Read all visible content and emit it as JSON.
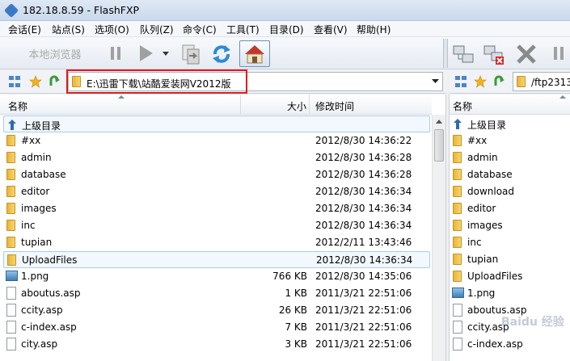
{
  "window": {
    "title": "182.18.8.59 - FlashFXP"
  },
  "menu": [
    "会话(E)",
    "站点(S)",
    "选项(O)",
    "队列(Z)",
    "命令(C)",
    "工具(T)",
    "目录(D)",
    "查看(V)",
    "帮助(H)"
  ],
  "toolbar": {
    "local_browser_label": "本地浏览器"
  },
  "left": {
    "path": "E:\\迅雷下载\\站酷爱装网V2012版",
    "columns": {
      "name": "名称",
      "size": "大小",
      "modified": "修改时间"
    },
    "parent_label": "上级目录",
    "rows": [
      {
        "name": "#xx",
        "size": "",
        "modified": "2012/8/30 14:36:22",
        "type": "folder"
      },
      {
        "name": "admin",
        "size": "",
        "modified": "2012/8/30 14:36:28",
        "type": "folder"
      },
      {
        "name": "database",
        "size": "",
        "modified": "2012/8/30 14:36:28",
        "type": "folder"
      },
      {
        "name": "editor",
        "size": "",
        "modified": "2012/8/30 14:36:34",
        "type": "folder"
      },
      {
        "name": "images",
        "size": "",
        "modified": "2012/8/30 14:36:34",
        "type": "folder"
      },
      {
        "name": "inc",
        "size": "",
        "modified": "2012/8/30 14:36:34",
        "type": "folder"
      },
      {
        "name": "tupian",
        "size": "",
        "modified": "2012/2/11 13:43:46",
        "type": "folder"
      },
      {
        "name": "UploadFiles",
        "size": "",
        "modified": "2012/8/30 14:36:34",
        "type": "folder"
      },
      {
        "name": "1.png",
        "size": "766 KB",
        "modified": "2012/8/30 14:35:06",
        "type": "png"
      },
      {
        "name": "aboutus.asp",
        "size": "1 KB",
        "modified": "2011/3/21 22:51:06",
        "type": "file"
      },
      {
        "name": "ccity.asp",
        "size": "26 KB",
        "modified": "2011/3/21 22:51:06",
        "type": "file"
      },
      {
        "name": "c-index.asp",
        "size": "7 KB",
        "modified": "2011/3/21 22:51:06",
        "type": "file"
      },
      {
        "name": "city.asp",
        "size": "3 KB",
        "modified": "2011/3/21 22:51:06",
        "type": "file"
      }
    ]
  },
  "right": {
    "path": "/ftp2313",
    "columns": {
      "name": "名称"
    },
    "parent_label": "上级目录",
    "rows": [
      {
        "name": "#xx",
        "type": "folder"
      },
      {
        "name": "admin",
        "type": "folder"
      },
      {
        "name": "database",
        "type": "folder"
      },
      {
        "name": "download",
        "type": "folder"
      },
      {
        "name": "editor",
        "type": "folder"
      },
      {
        "name": "images",
        "type": "folder"
      },
      {
        "name": "inc",
        "type": "folder"
      },
      {
        "name": "tupian",
        "type": "folder"
      },
      {
        "name": "UploadFiles",
        "type": "folder"
      },
      {
        "name": "1.png",
        "type": "png"
      },
      {
        "name": "aboutus.asp",
        "type": "file"
      },
      {
        "name": "ccity.asp",
        "type": "file"
      },
      {
        "name": "c-index.asp",
        "type": "file"
      }
    ]
  },
  "watermark": "Baidu 经验",
  "colors": {
    "highlight_box": "#e01b1b",
    "selection": "#a9cdef"
  }
}
